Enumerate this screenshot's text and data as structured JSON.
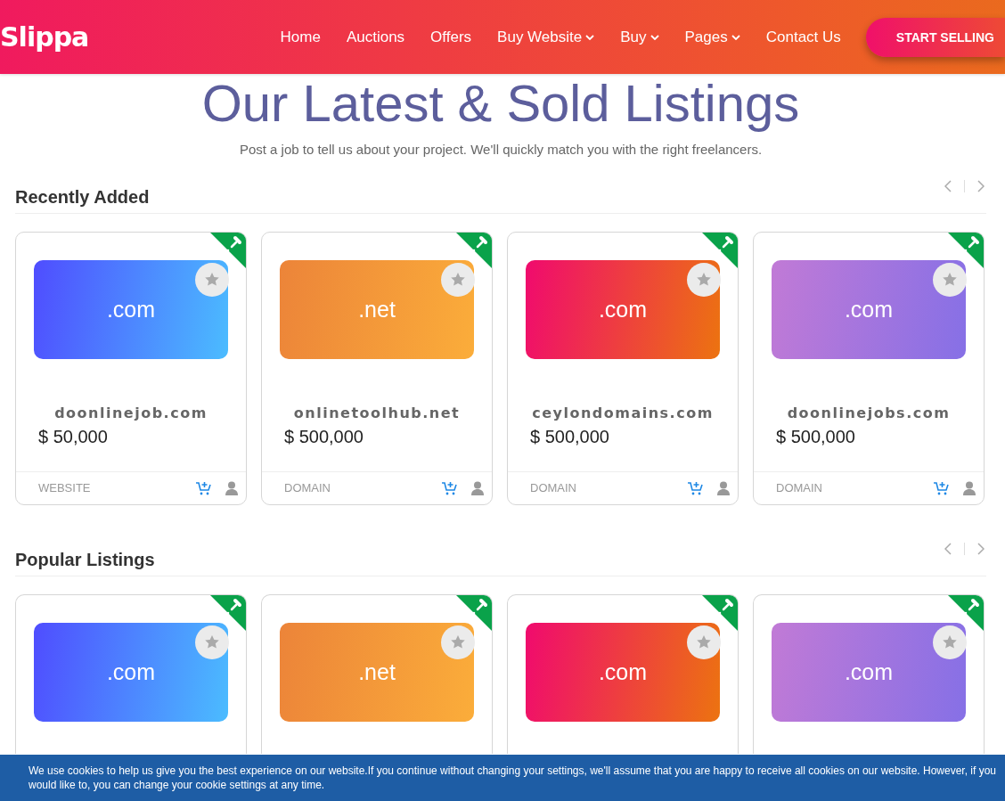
{
  "brand": "Slippa",
  "nav": [
    {
      "label": "Home",
      "dropdown": false
    },
    {
      "label": "Auctions",
      "dropdown": false
    },
    {
      "label": "Offers",
      "dropdown": false
    },
    {
      "label": "Buy Website",
      "dropdown": true
    },
    {
      "label": "Buy",
      "dropdown": true
    },
    {
      "label": "Pages",
      "dropdown": true
    },
    {
      "label": "Contact Us",
      "dropdown": false
    }
  ],
  "cta": "START SELLING",
  "title": "Our Latest & Sold Listings",
  "subtitle": "Post a job to tell us about your project. We'll quickly match you with the right freelancers.",
  "sections": [
    {
      "heading": "Recently Added",
      "cards": [
        {
          "tld": ".com",
          "kind": "blue",
          "name": "doonlinejob.com",
          "price": "$ 50,000",
          "category": "WEBSITE"
        },
        {
          "tld": ".net",
          "kind": "orange",
          "name": "onlinetoolhub.net",
          "price": "$ 500,000",
          "category": "DOMAIN"
        },
        {
          "tld": ".com",
          "kind": "sunset",
          "name": "ceylondomains.com",
          "price": "$ 500,000",
          "category": "DOMAIN"
        },
        {
          "tld": ".com",
          "kind": "violet",
          "name": "doonlinejobs.com",
          "price": "$ 500,000",
          "category": "DOMAIN"
        }
      ]
    },
    {
      "heading": "Popular Listings",
      "cards": [
        {
          "tld": ".com",
          "kind": "blue"
        },
        {
          "tld": ".net",
          "kind": "orange"
        },
        {
          "tld": ".com",
          "kind": "sunset"
        },
        {
          "tld": ".com",
          "kind": "violet"
        }
      ]
    }
  ],
  "cookie_notice": "We use cookies to help us give you the best experience on our website.If you continue without changing your settings, we'll assume that you are happy to receive all cookies on our website. However, if you would like to, you can change your cookie settings at any time."
}
